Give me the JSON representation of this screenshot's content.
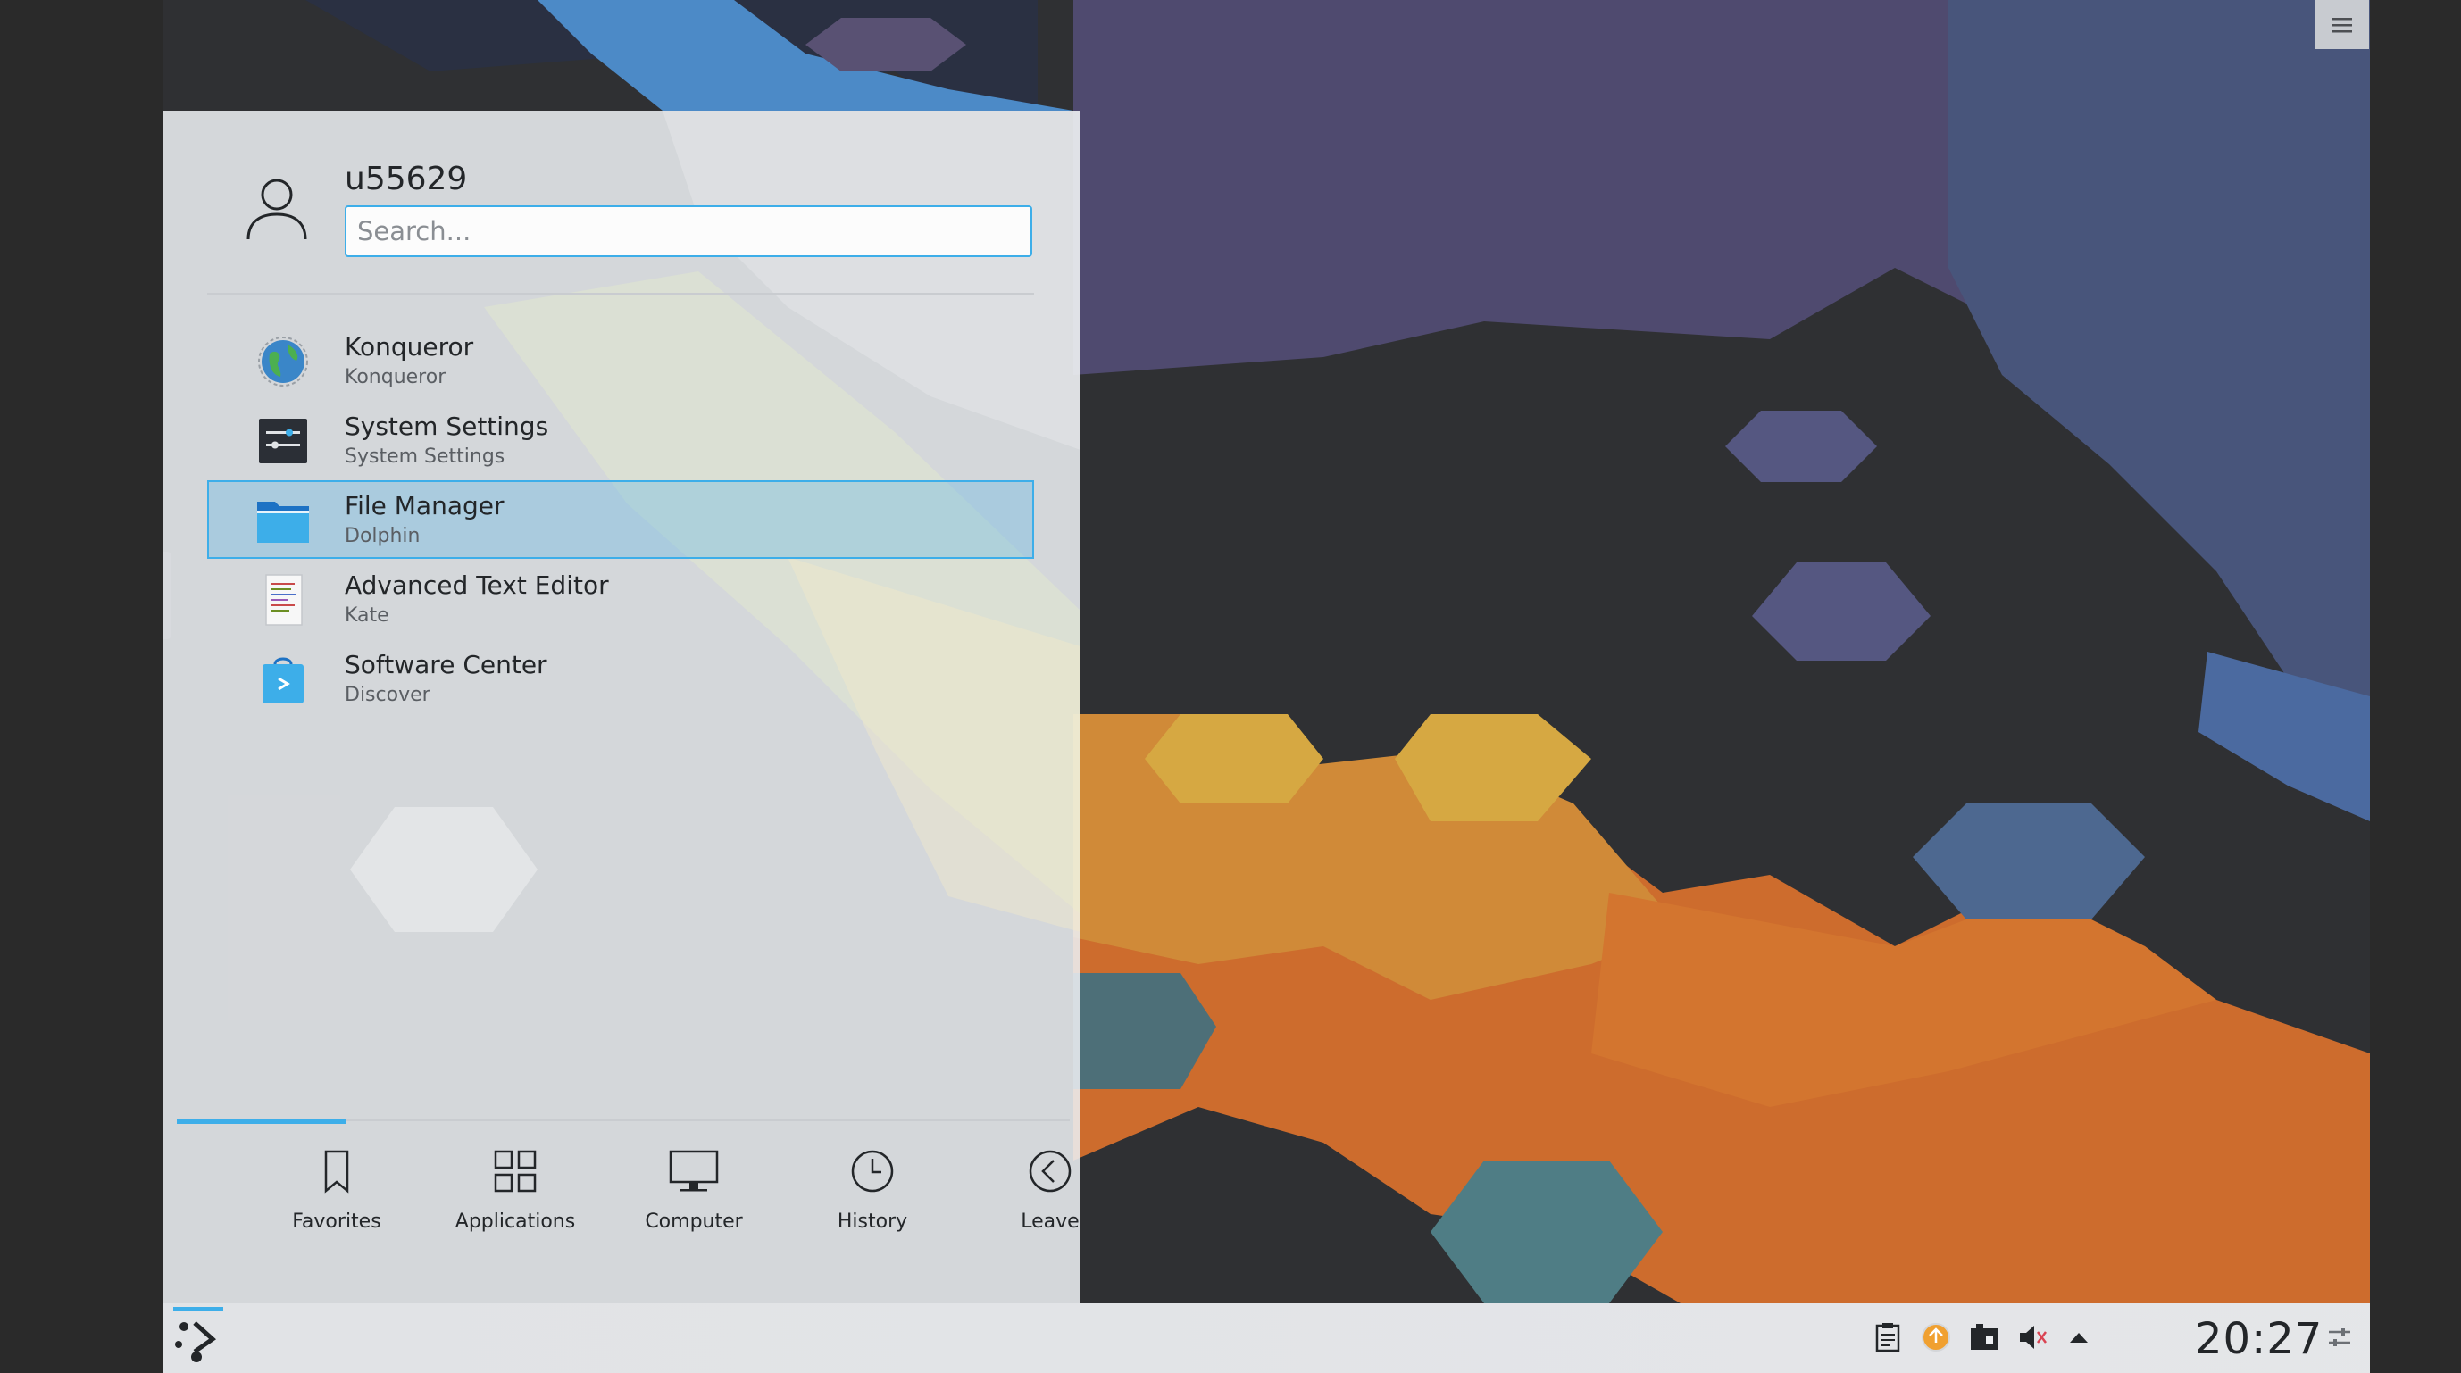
{
  "user": {
    "name": "u55629"
  },
  "search": {
    "placeholder": "Search..."
  },
  "favorites": [
    {
      "title": "Konqueror",
      "subtitle": "Konqueror",
      "icon": "konqueror-globe-icon"
    },
    {
      "title": "System Settings",
      "subtitle": "System Settings",
      "icon": "system-settings-icon"
    },
    {
      "title": "File Manager",
      "subtitle": "Dolphin",
      "icon": "folder-icon",
      "selected": true
    },
    {
      "title": "Advanced Text Editor",
      "subtitle": "Kate",
      "icon": "text-document-icon"
    },
    {
      "title": "Software Center",
      "subtitle": "Discover",
      "icon": "software-bag-icon"
    }
  ],
  "tabs": [
    {
      "label": "Favorites",
      "icon": "bookmark-icon",
      "active": true
    },
    {
      "label": "Applications",
      "icon": "grid-icon"
    },
    {
      "label": "Computer",
      "icon": "monitor-icon"
    },
    {
      "label": "History",
      "icon": "clock-icon"
    },
    {
      "label": "Leave",
      "icon": "arrow-left-circle-icon"
    }
  ],
  "tray": {
    "icons": [
      "clipboard-icon",
      "updates-icon",
      "network-icon",
      "volume-muted-icon",
      "expand-arrow-icon",
      "panel-settings-icon"
    ],
    "clock": "20:27"
  },
  "colors": {
    "accent": "#3daee9",
    "panel": "#eceef1",
    "text": "#232629"
  }
}
